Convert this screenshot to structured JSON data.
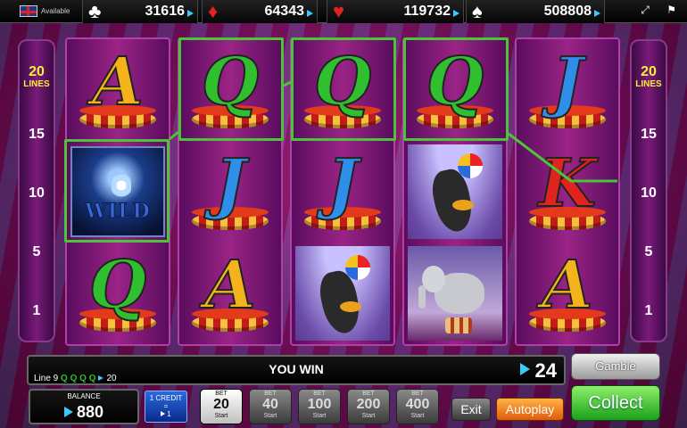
{
  "top_bar": {
    "tag": "Available",
    "jackpots": [
      {
        "suit": "clubs",
        "glyph": "♣",
        "value": "31616",
        "color": "#ffffff"
      },
      {
        "suit": "diamonds",
        "glyph": "♦",
        "value": "64343",
        "color": "#e0231f"
      },
      {
        "suit": "hearts",
        "glyph": "♥",
        "value": "119732",
        "color": "#e0231f"
      },
      {
        "suit": "spades",
        "glyph": "♠",
        "value": "508808",
        "color": "#ffffff"
      }
    ],
    "icons": [
      "fullscreen-icon",
      "flag-icon"
    ]
  },
  "lines_left": {
    "count": "20",
    "label": "LINES",
    "markers": [
      "15",
      "10",
      "5",
      "1"
    ]
  },
  "lines_right": {
    "count": "20",
    "label": "LINES",
    "markers": [
      "15",
      "10",
      "5",
      "1"
    ]
  },
  "reels": [
    [
      "A",
      "WILD",
      "Q"
    ],
    [
      "Q",
      "J",
      "A"
    ],
    [
      "Q",
      "J",
      "seal"
    ],
    [
      "Q",
      "seal",
      "elephant"
    ],
    [
      "J",
      "K",
      "A"
    ]
  ],
  "wild_label": "WILD",
  "win_panel": {
    "line_text": "Line 9",
    "line_symbols": "Q Q Q Q",
    "line_amount": "20",
    "title": "YOU WIN",
    "amount": "24"
  },
  "buttons": {
    "gamble": "Gamble",
    "exit": "Exit",
    "autoplay": "Autoplay",
    "collect": "Collect"
  },
  "balance": {
    "label": "BALANCE",
    "value": "880"
  },
  "credit": {
    "line1": "1 CREDIT",
    "line2": "=",
    "line3": "1"
  },
  "bets": [
    {
      "label": "BET",
      "value": "20",
      "sub": "Start",
      "active": true
    },
    {
      "label": "BET",
      "value": "40",
      "sub": "Start",
      "active": false
    },
    {
      "label": "BET",
      "value": "100",
      "sub": "Start",
      "active": false
    },
    {
      "label": "BET",
      "value": "200",
      "sub": "Start",
      "active": false
    },
    {
      "label": "BET",
      "value": "400",
      "sub": "Start",
      "active": false
    }
  ],
  "colors": {
    "win_line": "#4cc43a",
    "accent_blue": "#3cc7ff",
    "lines_yellow": "#f6f032"
  }
}
